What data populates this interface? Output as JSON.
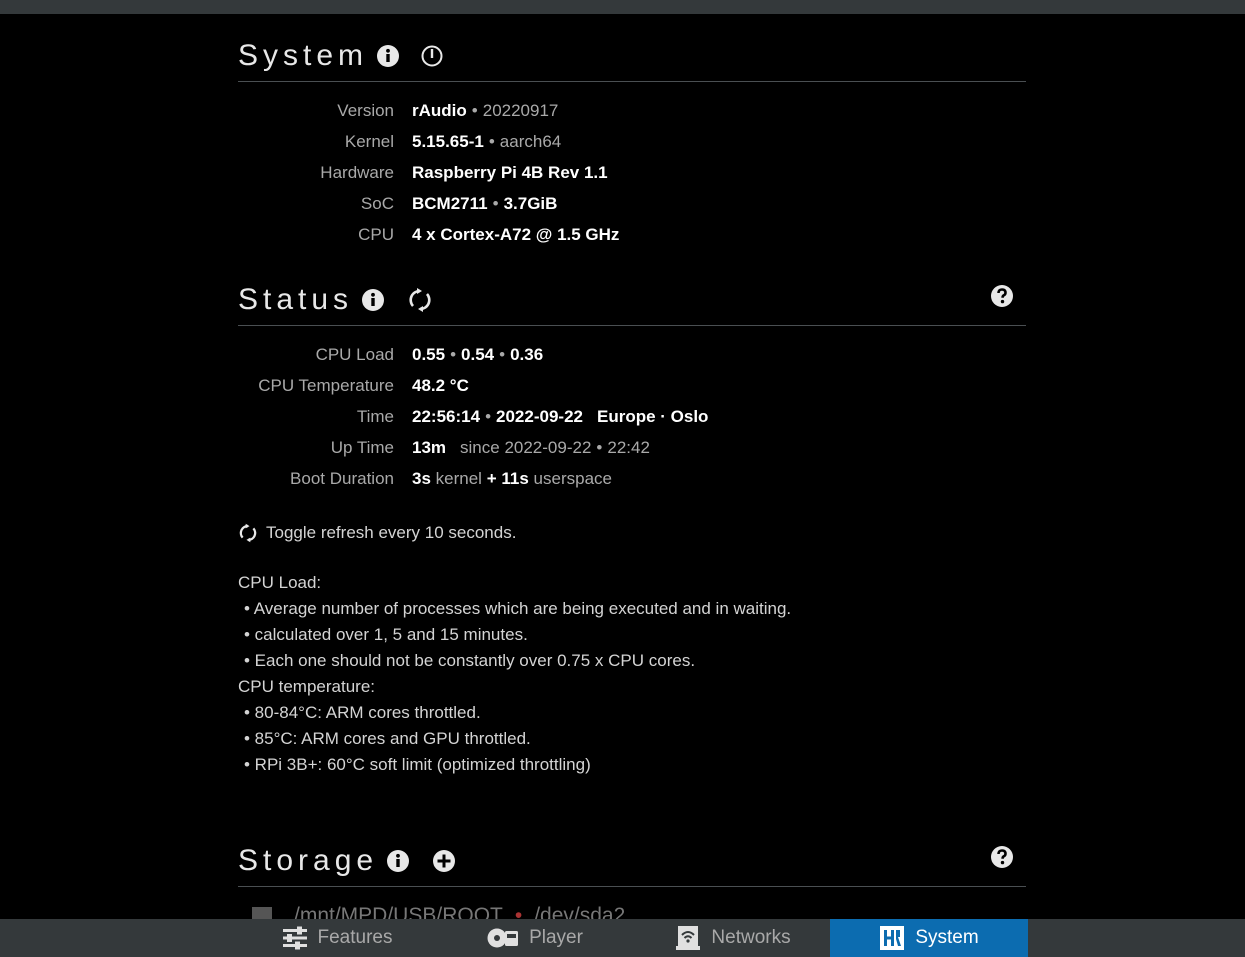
{
  "system": {
    "title": "System",
    "rows": [
      {
        "label": "Version",
        "v1": "rAudio",
        "v2": "20220917"
      },
      {
        "label": "Kernel",
        "v1": "5.15.65-1",
        "v2": "aarch64"
      },
      {
        "label": "Hardware",
        "v1": "Raspberry Pi 4B Rev 1.1"
      },
      {
        "label": "SoC",
        "v1": "BCM2711",
        "v2": "3.7GiB"
      },
      {
        "label": "CPU",
        "v1": "4 x Cortex-A72 @ 1.5 GHz"
      }
    ]
  },
  "status": {
    "title": "Status",
    "cpu_load": {
      "label": "CPU Load",
      "a": "0.55",
      "b": "0.54",
      "c": "0.36"
    },
    "cpu_temp": {
      "label": "CPU Temperature",
      "value": "48.2 °C"
    },
    "time": {
      "label": "Time",
      "clock": "22:56:14",
      "date": "2022-09-22",
      "zone": "Europe · Oslo"
    },
    "uptime": {
      "label": "Up Time",
      "value": "13m",
      "since": "since 2022-09-22",
      "since_time": "22:42"
    },
    "boot": {
      "label": "Boot Duration",
      "kernel_val": "3s",
      "kernel_txt": "kernel",
      "plus": "+",
      "user_val": "11s",
      "user_txt": "userspace"
    },
    "refresh_note": "Toggle refresh every 10 seconds.",
    "help": [
      "CPU Load:",
      "• Average number of processes which are being executed and in waiting.",
      "• calculated over 1, 5 and 15 minutes.",
      "• Each one should not be constantly over 0.75 x CPU cores.",
      "CPU temperature:",
      "• 80-84°C: ARM cores throttled.",
      "• 85°C: ARM cores and GPU throttled.",
      "• RPi 3B+: 60°C soft limit (optimized throttling)"
    ]
  },
  "storage": {
    "title": "Storage",
    "row_path": "/mnt/MPD/USB/ROOT",
    "row_dev": "/dev/sda2"
  },
  "nav": {
    "features": "Features",
    "player": "Player",
    "networks": "Networks",
    "system": "System"
  },
  "colors": {
    "accent": "#0c6cb0",
    "background": "#000000",
    "bar": "#34393b"
  },
  "icons": [
    "info-icon",
    "power-icon",
    "refresh-icon",
    "help-icon",
    "plus-icon",
    "sliders-icon",
    "player-icon",
    "network-icon",
    "system-icon"
  ]
}
